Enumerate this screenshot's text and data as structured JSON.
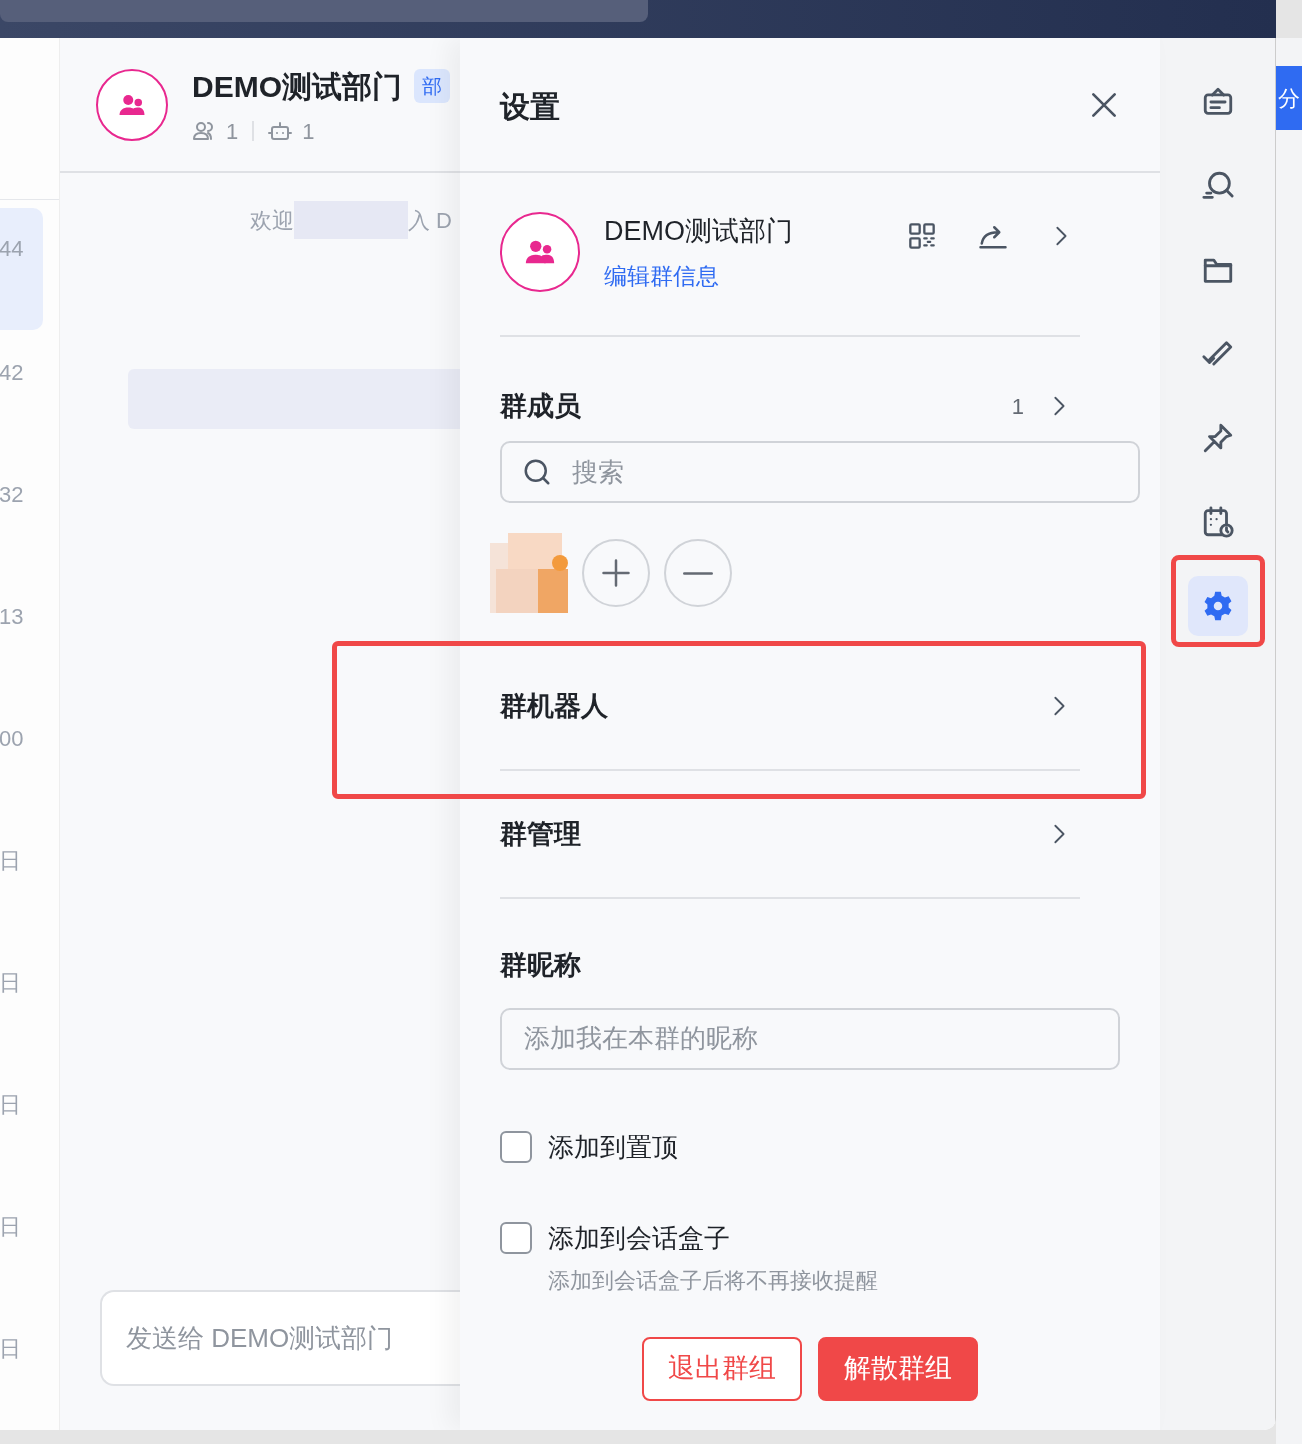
{
  "conversation_list": {
    "items": [
      {
        "time": "44",
        "selected": true
      },
      {
        "time": "42",
        "selected": false
      },
      {
        "time": "32",
        "selected": false
      },
      {
        "time": "13",
        "selected": false
      },
      {
        "time": "00",
        "selected": false
      },
      {
        "time": "日",
        "selected": false
      },
      {
        "time": "日",
        "selected": false
      },
      {
        "time": "日",
        "selected": false
      },
      {
        "time": "日",
        "selected": false
      },
      {
        "time": "日",
        "selected": false
      }
    ]
  },
  "chat": {
    "title": "DEMO测试部门",
    "badge": "部",
    "member_count": "1",
    "bot_count": "1",
    "welcome_prefix": "欢迎",
    "welcome_suffix": "入 D",
    "input_placeholder": "发送给 DEMO测试部门"
  },
  "settings": {
    "title": "设置",
    "group": {
      "name": "DEMO测试部门",
      "edit_link": "编辑群信息"
    },
    "members": {
      "label": "群成员",
      "count": "1",
      "search_placeholder": "搜索"
    },
    "rows": [
      {
        "label": "群机器人",
        "annotated": true
      },
      {
        "label": "群管理",
        "annotated": false
      }
    ],
    "nickname": {
      "label": "群昵称",
      "placeholder": "添加我在本群的昵称"
    },
    "options": [
      {
        "label": "添加到置顶",
        "checked": false
      },
      {
        "label": "添加到会话盒子",
        "checked": false,
        "hint": "添加到会话盒子后将不再接收提醒"
      }
    ],
    "buttons": [
      {
        "label": "退出群组",
        "kind": "outline"
      },
      {
        "label": "解散群组",
        "kind": "danger"
      }
    ]
  },
  "side_toolbar": {
    "items": [
      {
        "kind": "board",
        "selected": false,
        "annotated": false
      },
      {
        "kind": "search",
        "selected": false,
        "annotated": false
      },
      {
        "kind": "folder",
        "selected": false,
        "annotated": false
      },
      {
        "kind": "check",
        "selected": false,
        "annotated": false
      },
      {
        "kind": "pin",
        "selected": false,
        "annotated": false
      },
      {
        "kind": "calendar",
        "selected": false,
        "annotated": false
      },
      {
        "kind": "gear",
        "selected": true,
        "annotated": true
      }
    ]
  },
  "background_button": {
    "label": "分"
  }
}
